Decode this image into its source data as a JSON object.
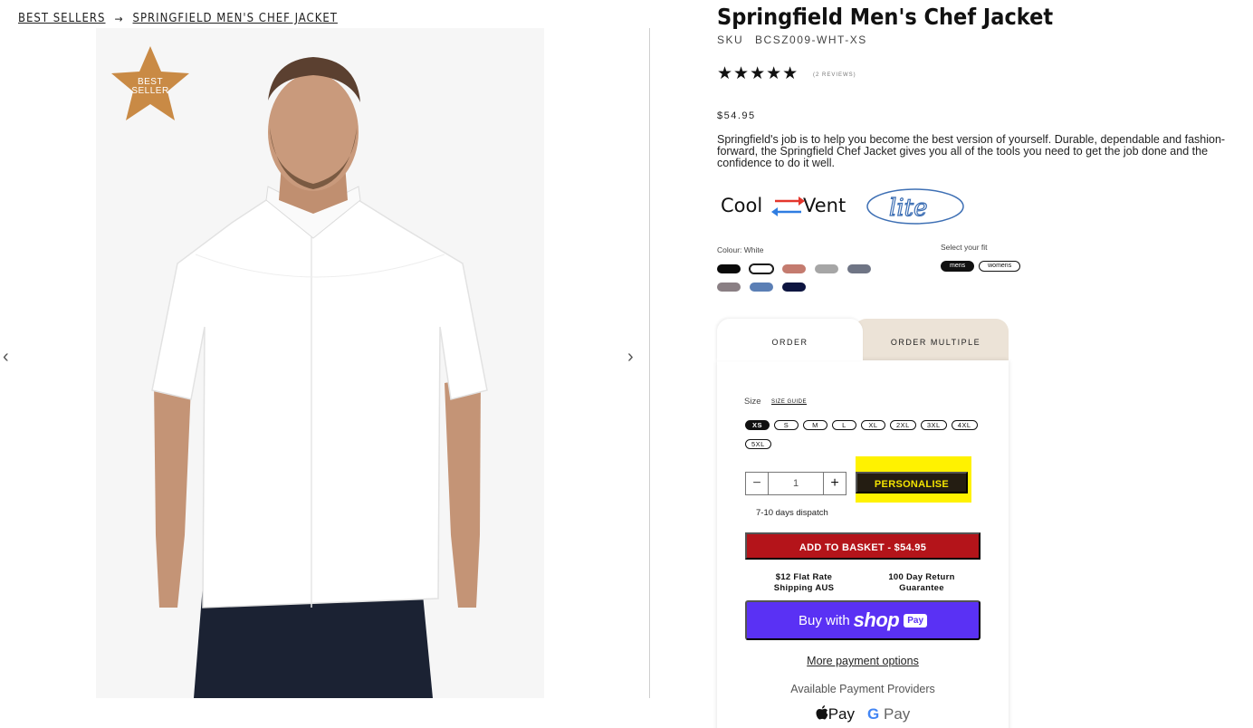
{
  "breadcrumb": {
    "items": [
      "BEST SELLERS",
      "SPRINGFIELD MEN'S CHEF JACKET"
    ],
    "separator": "→"
  },
  "gallery": {
    "badge": {
      "line1": "BEST",
      "line2": "SELLER",
      "color": "#c98a45"
    },
    "prev_icon": "chevron-left-icon",
    "next_icon": "chevron-right-icon"
  },
  "product": {
    "title": "Springfield Men's Chef Jacket",
    "sku_label": "SKU",
    "sku": "BCSZ009-WHT-XS",
    "stars": "★★★★★",
    "rating": 5,
    "reviews": "(2 REVIEWS)",
    "price": "$54.95",
    "description": "Springfield's job is to help you become the best version of yourself. Durable, dependable and fashion-forward, the Springfield Chef Jacket gives you all of the tools you need to get the job done and the confidence to do it well.",
    "features": {
      "coolvent_left": "Cool",
      "coolvent_right": "Vent",
      "lite": "lite"
    }
  },
  "colour": {
    "label": "Colour: White",
    "swatches": [
      {
        "name": "black",
        "color": "#0a0a0a",
        "selected": false
      },
      {
        "name": "white",
        "color": "#ffffff",
        "selected": true
      },
      {
        "name": "terracotta",
        "color": "#c47b6f",
        "selected": false
      },
      {
        "name": "light-grey",
        "color": "#a6a6a6",
        "selected": false
      },
      {
        "name": "slate",
        "color": "#6f7585",
        "selected": false
      },
      {
        "name": "taupe",
        "color": "#8a7f84",
        "selected": false
      },
      {
        "name": "blue",
        "color": "#5b7fb5",
        "selected": false
      },
      {
        "name": "navy",
        "color": "#0d1540",
        "selected": false
      }
    ]
  },
  "fit": {
    "label": "Select your fit",
    "options": [
      {
        "label": "mens",
        "active": true
      },
      {
        "label": "womens",
        "active": false
      }
    ]
  },
  "tabs": {
    "order": "ORDER",
    "order_multiple": "ORDER MULTIPLE"
  },
  "order": {
    "size_label": "Size",
    "size_guide": "SIZE GUIDE",
    "sizes": [
      {
        "label": "XS",
        "active": true
      },
      {
        "label": "S",
        "active": false
      },
      {
        "label": "M",
        "active": false
      },
      {
        "label": "L",
        "active": false
      },
      {
        "label": "XL",
        "active": false
      },
      {
        "label": "2XL",
        "active": false
      },
      {
        "label": "3XL",
        "active": false
      },
      {
        "label": "4XL",
        "active": false
      },
      {
        "label": "5XL",
        "active": false
      }
    ],
    "qty_minus": "−",
    "qty_plus": "+",
    "quantity": "1",
    "personalise": "PERSONALISE",
    "dispatch": "7-10 days dispatch",
    "add_to_basket": "ADD TO BASKET - $54.95",
    "perk_shipping_line1": "$12 Flat Rate",
    "perk_shipping_line2": "Shipping AUS",
    "perk_return_line1": "100 Day Return",
    "perk_return_line2": "Guarantee",
    "shop_pay": {
      "buy_with": "Buy with",
      "shop": "shop",
      "pay": "Pay",
      "color": "#5a31f4"
    },
    "more_payment": "More payment options",
    "providers_label": "Available Payment Providers",
    "apple_pay": "Pay",
    "google_g": "G",
    "google_pay": "Pay"
  },
  "colors": {
    "add_basket": "#b4141a",
    "personalise_bg": "#241d12",
    "personalise_text": "#f4e400",
    "highlight": "#fff200",
    "tab_inactive": "#ece3d7"
  }
}
